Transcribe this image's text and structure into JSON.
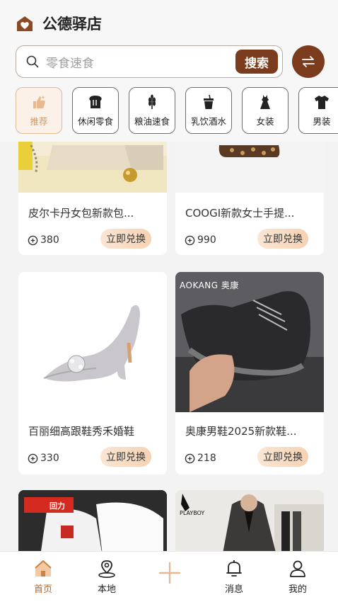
{
  "header": {
    "app_title": "公德驿店",
    "search_placeholder": "零食速食",
    "search_button": "搜索"
  },
  "categories": [
    {
      "label": "推荐",
      "icon": "thumbs-up-icon",
      "active": true
    },
    {
      "label": "休闲零食",
      "icon": "bread-icon",
      "active": false
    },
    {
      "label": "粮油速食",
      "icon": "wheat-icon",
      "active": false
    },
    {
      "label": "乳饮酒水",
      "icon": "drink-cup-icon",
      "active": false
    },
    {
      "label": "女装",
      "icon": "dress-icon",
      "active": false
    },
    {
      "label": "男装",
      "icon": "shirt-icon",
      "active": false
    }
  ],
  "products": [
    {
      "name": "皮尔卡丹女包新款包...",
      "points": "380",
      "action": "立即兑换"
    },
    {
      "name": "COOGI新款女士手提...",
      "points": "990",
      "action": "立即兑换"
    },
    {
      "name": "百丽细高跟鞋秀禾婚鞋",
      "points": "330",
      "action": "立即兑换"
    },
    {
      "name": "奥康男鞋2025新款鞋...",
      "points": "218",
      "action": "立即兑换"
    }
  ],
  "image_texts": {
    "aokang_logo": "AOKANG 奥康",
    "warrior_logo": "回力",
    "playboy_logo": "PLAYBOY"
  },
  "tabbar": {
    "home": "首页",
    "local": "本地",
    "messages": "消息",
    "mine": "我的"
  },
  "colors": {
    "brand_brown": "#7a3c1c",
    "accent_orange": "#d29a6a",
    "redeem_bg": "#f6d2b3"
  }
}
